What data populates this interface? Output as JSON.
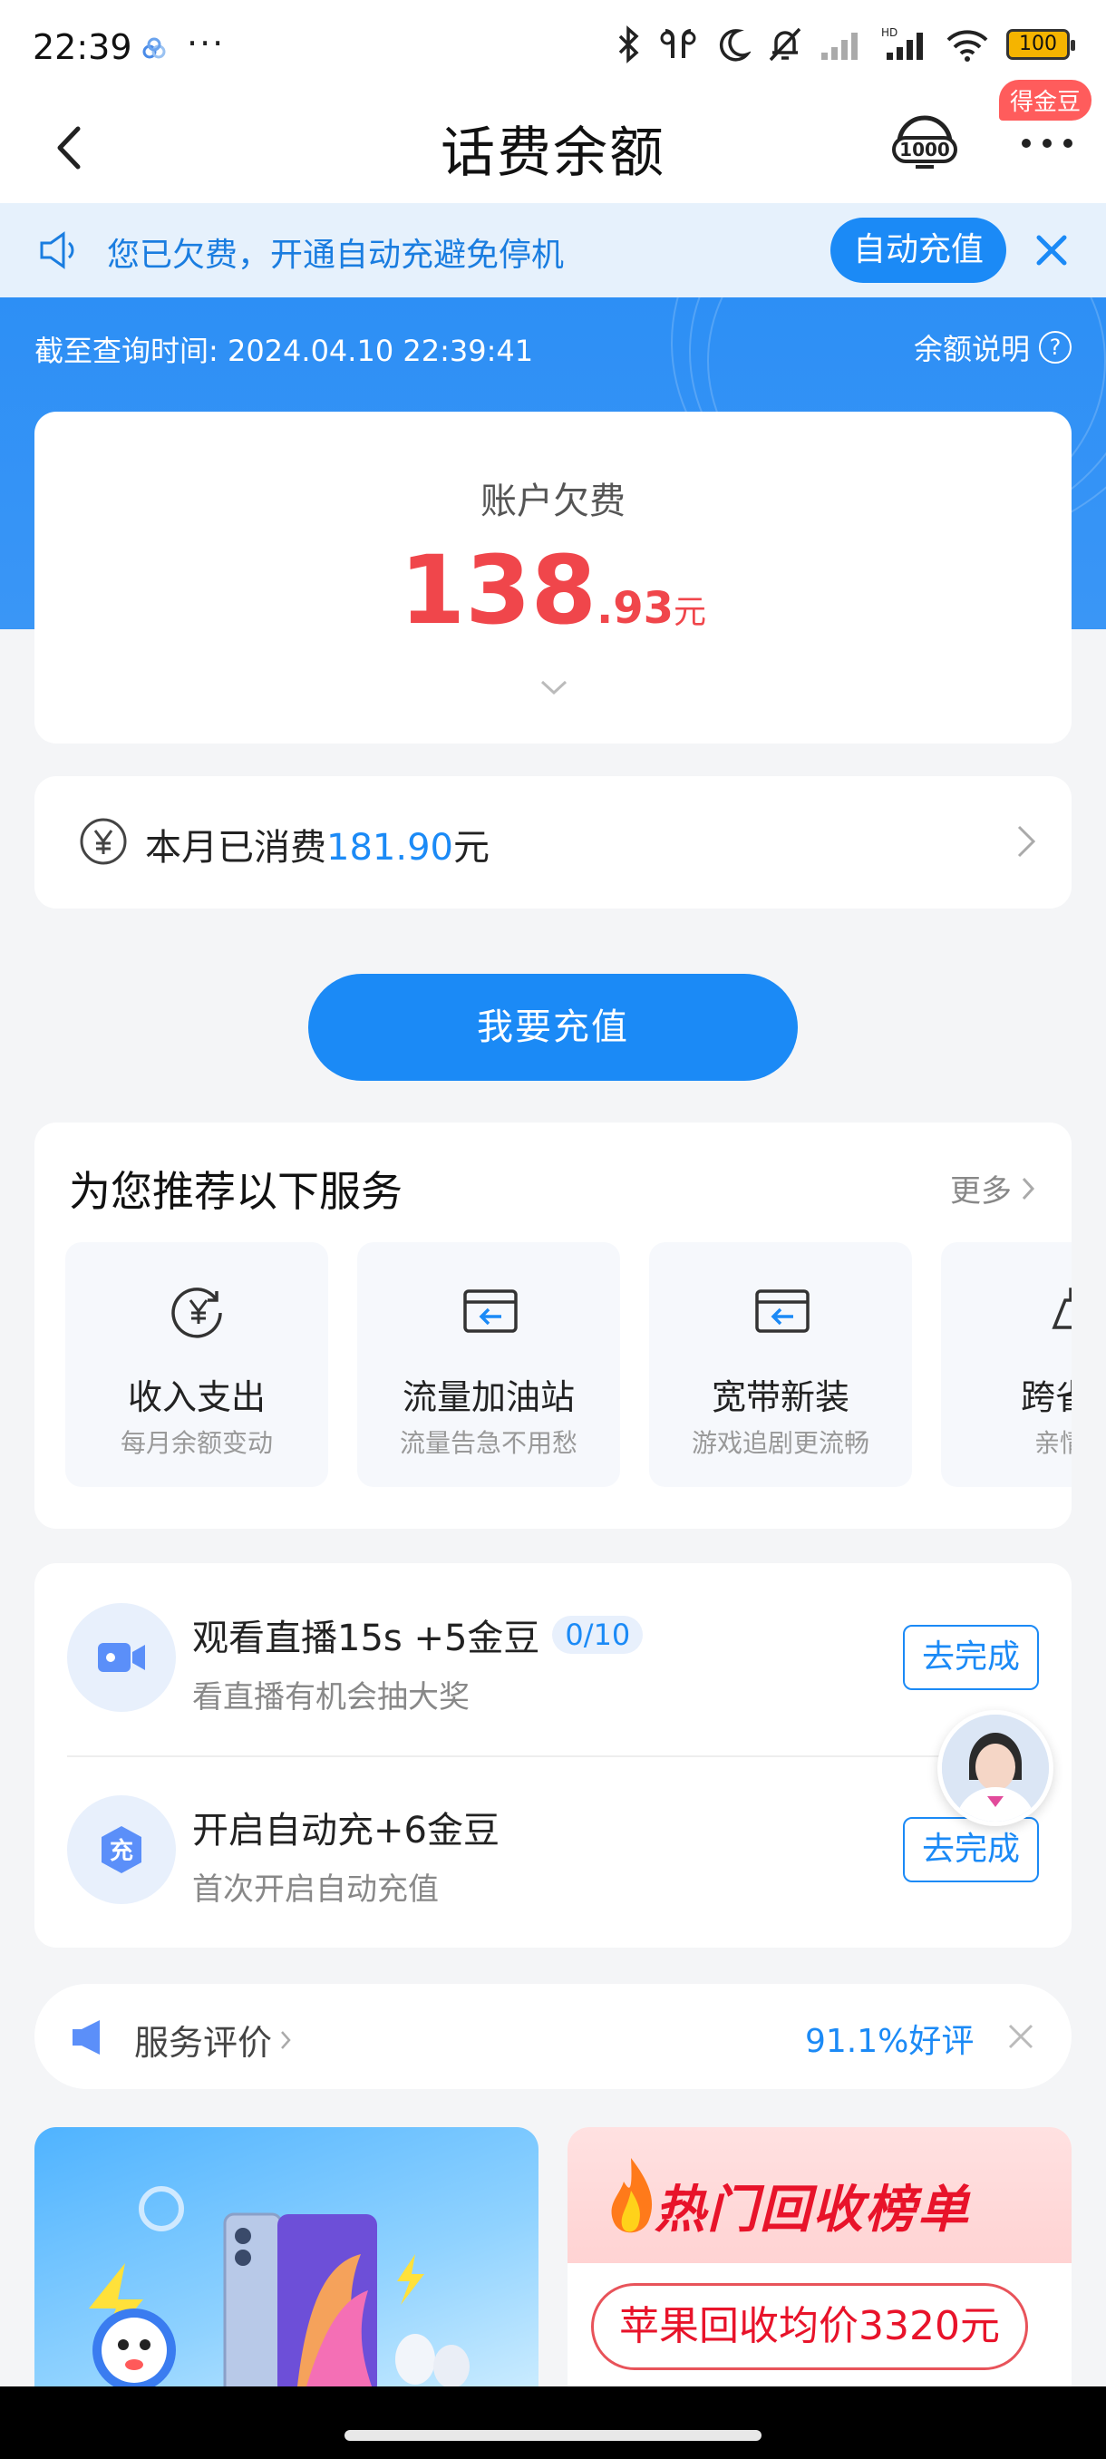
{
  "status_bar": {
    "time": "22:39",
    "dots": "···",
    "battery": "100"
  },
  "nav": {
    "title": "话费余额",
    "badge": "得金豆"
  },
  "notice": {
    "text": "您已欠费，开通自动充避免停机",
    "button": "自动充值"
  },
  "header": {
    "query_time": "截至查询时间: 2024.04.10 22:39:41",
    "balance_help": "余额说明",
    "help_symbol": "?"
  },
  "balance": {
    "label": "账户欠费",
    "integer": "138",
    "decimal": ".93",
    "unit": "元"
  },
  "monthly": {
    "prefix": "本月已消费",
    "value": "181.90",
    "unit": "元"
  },
  "recharge_button": "我要充值",
  "recommend": {
    "title": "为您推荐以下服务",
    "more": "更多",
    "items": [
      {
        "name": "收入支出",
        "desc": "每月余额变动",
        "icon": "yen-cycle-icon"
      },
      {
        "name": "流量加油站",
        "desc": "流量告急不用愁",
        "icon": "card-arrow-icon"
      },
      {
        "name": "宽带新装",
        "desc": "游戏追剧更流畅",
        "icon": "card-arrow-icon"
      },
      {
        "name": "跨省办",
        "desc": "亲情一",
        "icon": "cart-icon"
      }
    ]
  },
  "tasks": [
    {
      "title": "观看直播15s +5金豆",
      "progress": "0/10",
      "subtitle": "看直播有机会抽大奖",
      "button": "去完成",
      "icon": "video-camera-icon"
    },
    {
      "title": "开启自动充+6金豆",
      "progress": "",
      "subtitle": "首次开启自动充值",
      "button": "去完成",
      "icon_text": "充"
    }
  ],
  "rating": {
    "label": "服务评价",
    "score": "91.1%好评"
  },
  "banners": {
    "right_title": "热门回收榜单",
    "right_pill": "苹果回收均价3320元"
  },
  "colors": {
    "primary": "#1b8af6",
    "debt_red": "#f0464b",
    "header_blue": "#2d8ff5"
  }
}
